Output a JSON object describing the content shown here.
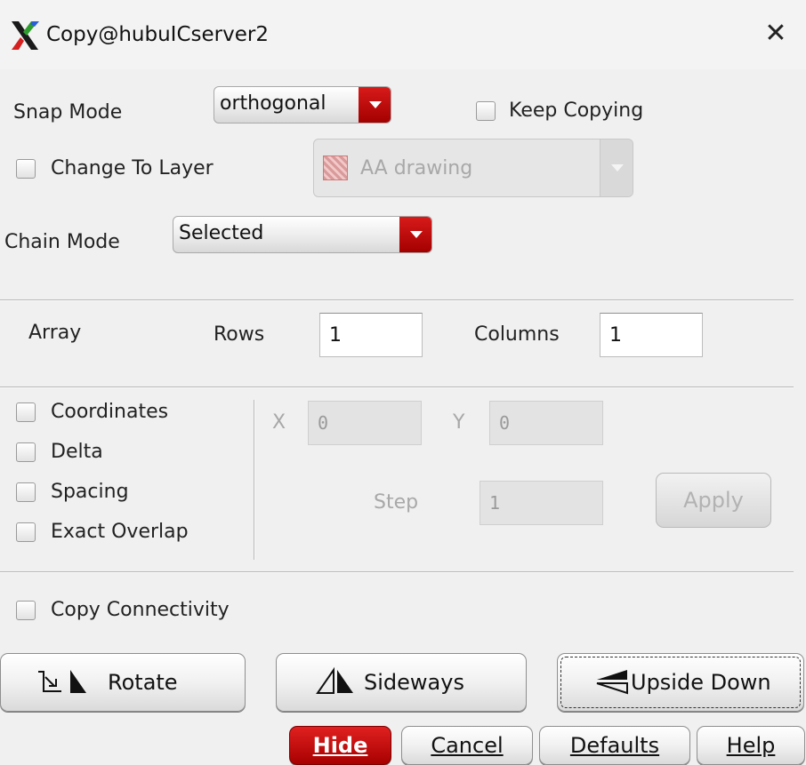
{
  "window": {
    "title": "Copy@hubuICserver2",
    "app_icon": "x11-icon",
    "close_icon": "close-icon"
  },
  "snap_mode": {
    "label": "Snap Mode",
    "value": "orthogonal"
  },
  "keep_copying": {
    "label": "Keep Copying",
    "checked": false
  },
  "change_to_layer": {
    "label": "Change To Layer",
    "checked": false,
    "layer_value": "AA drawing",
    "enabled": false
  },
  "chain_mode": {
    "label": "Chain Mode",
    "value": "Selected"
  },
  "array": {
    "label": "Array",
    "rows_label": "Rows",
    "rows_value": "1",
    "columns_label": "Columns",
    "columns_value": "1"
  },
  "options": {
    "coordinates": {
      "label": "Coordinates",
      "checked": false
    },
    "delta": {
      "label": "Delta",
      "checked": false
    },
    "spacing": {
      "label": "Spacing",
      "checked": false
    },
    "exact_overlap": {
      "label": "Exact Overlap",
      "checked": false
    }
  },
  "coords": {
    "x_label": "X",
    "x_value": "0",
    "y_label": "Y",
    "y_value": "0",
    "step_label": "Step",
    "step_value": "1",
    "apply_label": "Apply"
  },
  "copy_connectivity": {
    "label": "Copy Connectivity",
    "checked": false
  },
  "transform_buttons": {
    "rotate": "Rotate",
    "sideways": "Sideways",
    "upside_down": "Upside Down"
  },
  "footer": {
    "hide": "Hide",
    "cancel": "Cancel",
    "defaults": "Defaults",
    "help": "Help"
  },
  "colors": {
    "accent_red": "#c40000",
    "background": "#f0f0f0"
  }
}
